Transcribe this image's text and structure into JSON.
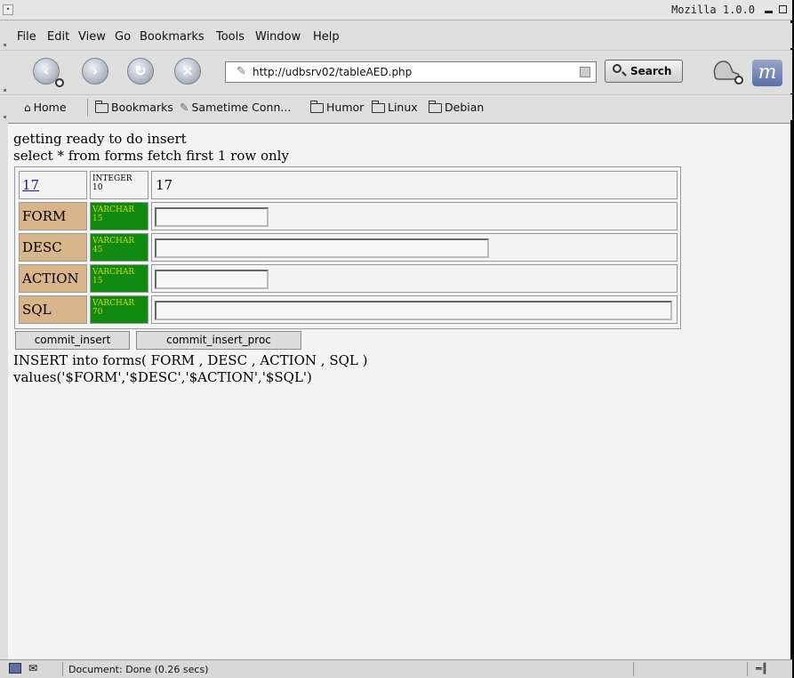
{
  "window": {
    "title": "Mozilla 1.0.0"
  },
  "menu": [
    "File",
    "Edit",
    "View",
    "Go",
    "Bookmarks",
    "Tools",
    "Window",
    "Help"
  ],
  "nav": {
    "url": "http://udbsrv02/tableAED.php",
    "search_label": "Search"
  },
  "bookmarks": [
    "Home",
    "Bookmarks",
    "Sametime Conn...",
    "Humor",
    "Linux",
    "Debian"
  ],
  "content": {
    "line1": "getting ready to do insert",
    "line2": "select * from forms fetch first 1 row only",
    "rows": [
      {
        "name": "17",
        "type": "INTEGER",
        "len": "10",
        "value": "17"
      },
      {
        "name": "FORM",
        "type": "VARCHAR",
        "len": "15",
        "value": ""
      },
      {
        "name": "DESC",
        "type": "VARCHAR",
        "len": "45",
        "value": ""
      },
      {
        "name": "ACTION",
        "type": "VARCHAR",
        "len": "15",
        "value": ""
      },
      {
        "name": "SQL",
        "type": "VARCHAR",
        "len": "70",
        "value": ""
      }
    ],
    "buttons": {
      "commit_insert": "commit_insert",
      "commit_insert_proc": "commit_insert_proc"
    },
    "sql1": "INSERT into forms( FORM , DESC , ACTION , SQL )",
    "sql2": "values('$FORM','$DESC','$ACTION','$SQL')"
  },
  "status": {
    "text": "Document: Done (0.26 secs)"
  }
}
